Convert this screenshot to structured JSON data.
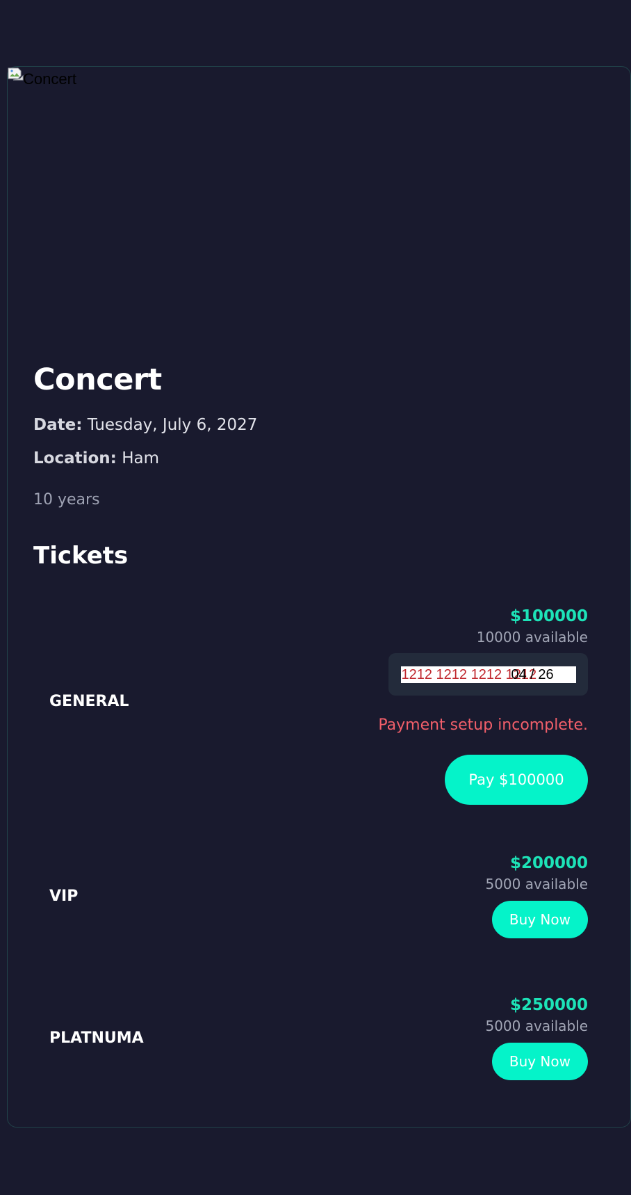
{
  "event": {
    "image_alt": "Concert",
    "title": "Concert",
    "date_label": "Date:",
    "date_value": "Tuesday, July 6, 2027",
    "location_label": "Location:",
    "location_value": "Ham",
    "duration": "10 years"
  },
  "tickets": {
    "heading": "Tickets",
    "tiers": [
      {
        "name": "GENERAL",
        "price": "$100000",
        "available": "10000 available",
        "card_number": "1212 1212 1212 1212",
        "card_expiry": "04 / 26",
        "error": "Payment setup incomplete.",
        "pay_label": "Pay $100000"
      },
      {
        "name": "VIP",
        "price": "$200000",
        "available": "5000 available",
        "buy_label": "Buy Now"
      },
      {
        "name": "PLATNUMA",
        "price": "$250000",
        "available": "5000 available",
        "buy_label": "Buy Now"
      }
    ]
  },
  "colors": {
    "background": "#191a2e",
    "accent": "#05f3c9",
    "price": "#1de3b8",
    "error": "#f25f6a"
  }
}
